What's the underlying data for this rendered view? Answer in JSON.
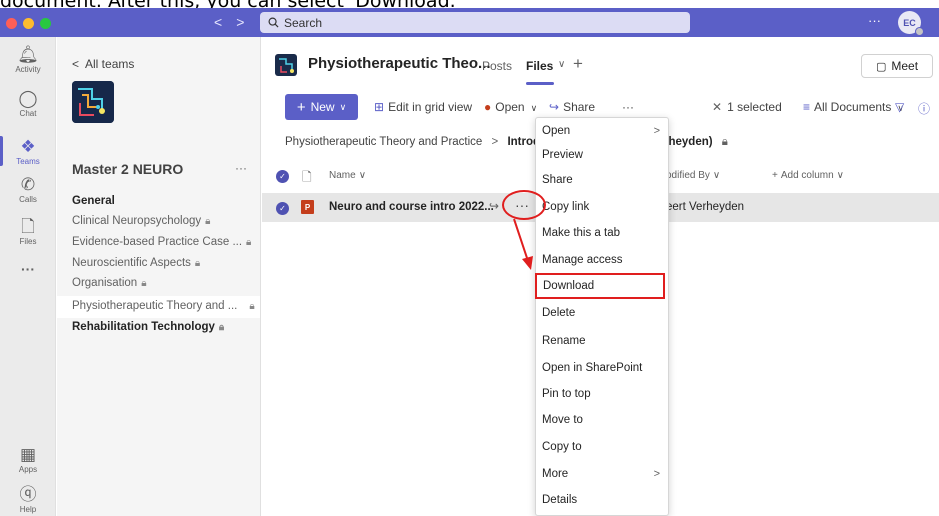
{
  "caption": "document. After this, you can select 'Download.'",
  "titlebar": {
    "nav_back": "<",
    "nav_forward": ">",
    "search_placeholder": "Search",
    "more": "···",
    "avatar_initials": "EC",
    "accent": "#5b5fc7"
  },
  "rail": {
    "items": [
      {
        "label": "Activity",
        "icon": "bell-icon"
      },
      {
        "label": "Chat",
        "icon": "chat-icon"
      },
      {
        "label": "Teams",
        "icon": "teams-icon"
      },
      {
        "label": "Calls",
        "icon": "phone-icon"
      },
      {
        "label": "Files",
        "icon": "file-icon"
      },
      {
        "label": "···",
        "icon": "more-icon"
      }
    ],
    "bottom": [
      {
        "label": "Apps",
        "icon": "apps-icon"
      },
      {
        "label": "Help",
        "icon": "help-icon"
      }
    ]
  },
  "panel": {
    "all_teams": "All teams",
    "team_name": "Master 2 NEURO",
    "team_more": "···",
    "channels": [
      {
        "label": "General",
        "bold": true,
        "locked": false
      },
      {
        "label": "Clinical Neuropsychology",
        "bold": false,
        "locked": true
      },
      {
        "label": "Evidence-based Practice Case ...",
        "bold": false,
        "locked": true
      },
      {
        "label": "Neuroscientific Aspects",
        "bold": false,
        "locked": true
      },
      {
        "label": "Organisation",
        "bold": false,
        "locked": true
      },
      {
        "label": "Physiotherapeutic Theory and ...",
        "bold": false,
        "locked": true,
        "selected": true
      },
      {
        "label": "Rehabilitation Technology",
        "bold": true,
        "locked": true
      }
    ]
  },
  "main": {
    "channel_title": "Physiotherapeutic Theo...",
    "tabs": {
      "posts": "Posts",
      "files": "Files",
      "add": "+"
    },
    "meet_label": "Meet",
    "toolbar": {
      "new": "New",
      "edit_grid": "Edit in grid view",
      "open": "Open",
      "share": "Share",
      "more": "···",
      "selected": "1 selected",
      "all_docs": "All Documents"
    },
    "breadcrumb": {
      "root": "Physiotherapeutic Theory and Practice",
      "current": "Introduct",
      "tail": "rheyden)"
    },
    "columns": {
      "name": "Name",
      "modified_by": "odified By",
      "add_column": "Add column"
    },
    "file": {
      "name": "Neuro and course intro 2022...",
      "modified_by": "eert Verheyden",
      "more": "···"
    }
  },
  "context_menu": {
    "items": [
      {
        "label": "Open",
        "submenu": true
      },
      {
        "label": "Preview",
        "submenu": false
      },
      {
        "label": "Share",
        "submenu": false
      },
      {
        "label": "Copy link",
        "submenu": false
      },
      {
        "label": "Make this a tab",
        "submenu": false
      },
      {
        "label": "Manage access",
        "submenu": false
      },
      {
        "label": "Download",
        "submenu": false,
        "highlighted": true
      },
      {
        "label": "Delete",
        "submenu": false
      },
      {
        "label": "Rename",
        "submenu": false
      },
      {
        "label": "Open in SharePoint",
        "submenu": false
      },
      {
        "label": "Pin to top",
        "submenu": false
      },
      {
        "label": "Move to",
        "submenu": false
      },
      {
        "label": "Copy to",
        "submenu": false
      },
      {
        "label": "More",
        "submenu": true
      },
      {
        "label": "Details",
        "submenu": false
      }
    ]
  },
  "annotation_color": "#e01e1e"
}
